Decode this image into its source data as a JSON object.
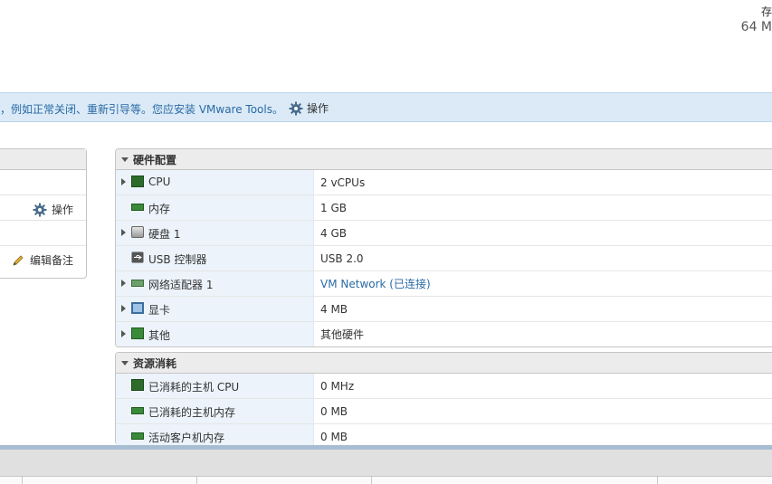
{
  "stats": {
    "storage_label": "存",
    "storage_value": "64 M"
  },
  "banner": {
    "text": "，例如正常关闭、重新引导等。您应安装 VMware Tools。",
    "action_label": "操作"
  },
  "left_panel": {
    "action_label": "操作",
    "edit_notes_label": "编辑备注"
  },
  "hardware": {
    "title": "硬件配置",
    "rows": [
      {
        "label": "CPU",
        "value": "2 vCPUs",
        "icon": "cpu-icon",
        "expandable": true
      },
      {
        "label": "内存",
        "value": "1 GB",
        "icon": "memory-icon",
        "expandable": false
      },
      {
        "label": "硬盘 1",
        "value": "4 GB",
        "icon": "hard-disk-icon",
        "expandable": true
      },
      {
        "label": "USB 控制器",
        "value": "USB 2.0",
        "icon": "usb-icon",
        "expandable": false
      },
      {
        "label": "网络适配器 1",
        "value": "VM Network (已连接)",
        "icon": "network-adapter-icon",
        "expandable": true,
        "link": true
      },
      {
        "label": "显卡",
        "value": "4 MB",
        "icon": "display-icon",
        "expandable": true
      },
      {
        "label": "其他",
        "value": "其他硬件",
        "icon": "other-hardware-icon",
        "expandable": true
      }
    ]
  },
  "resources": {
    "title": "资源消耗",
    "rows": [
      {
        "label": "已消耗的主机 CPU",
        "value": "0 MHz",
        "icon": "cpu-icon"
      },
      {
        "label": "已消耗的主机内存",
        "value": "0 MB",
        "icon": "memory-icon"
      },
      {
        "label": "活动客户机内存",
        "value": "0 MB",
        "icon": "memory-icon"
      }
    ]
  },
  "colors": {
    "accent": "#2a6aa6",
    "banner_bg": "#dbeaf6",
    "label_bg": "#ecf3fa"
  }
}
